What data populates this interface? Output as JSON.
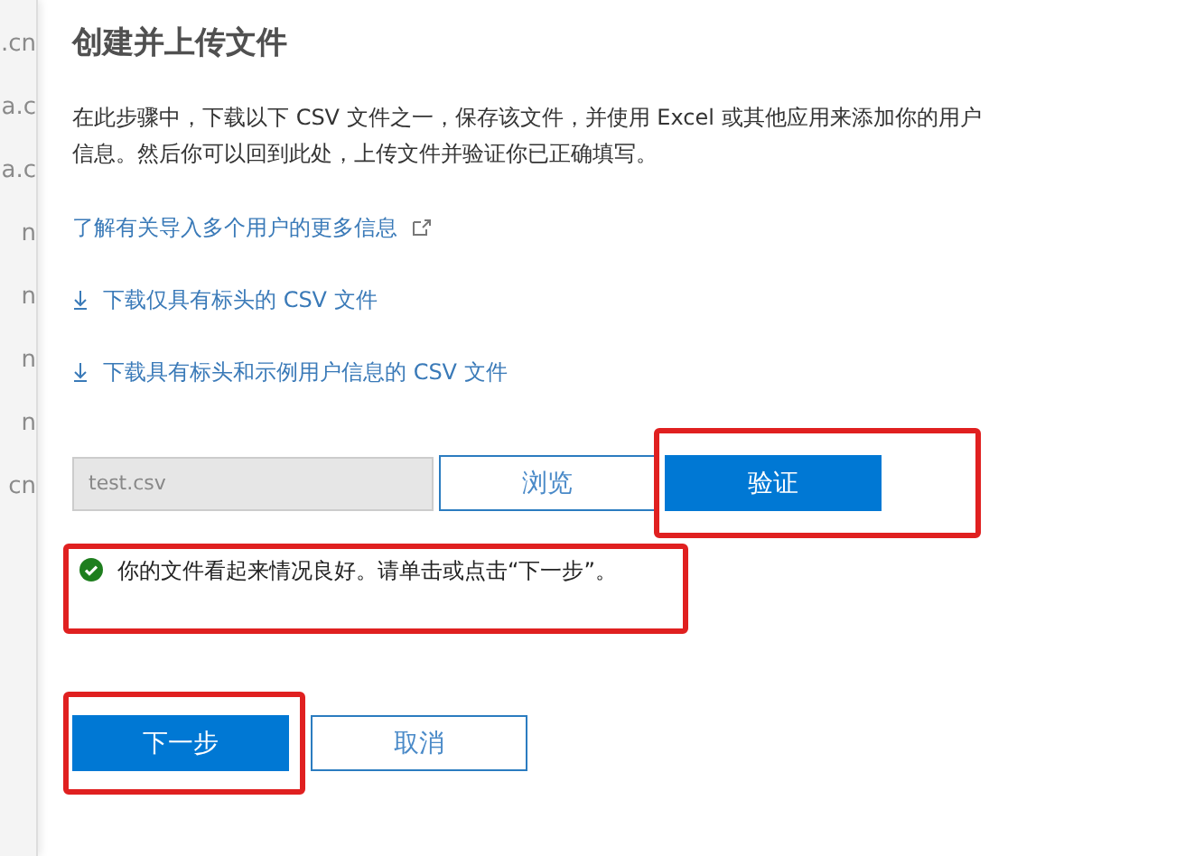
{
  "background_fragments": [
    ".cn",
    "a.c",
    "a.c",
    "n",
    "n",
    "n",
    "n",
    "cn"
  ],
  "panel": {
    "title": "创建并上传文件",
    "description": "在此步骤中，下载以下 CSV 文件之一，保存该文件，并使用 Excel 或其他应用来添加你的用户信息。然后你可以回到此处，上传文件并验证你已正确填写。",
    "links": [
      {
        "kind": "external",
        "label": "了解有关导入多个用户的更多信息"
      },
      {
        "kind": "download",
        "label": "下载仅具有标头的 CSV 文件"
      },
      {
        "kind": "download",
        "label": "下载具有标头和示例用户信息的 CSV 文件"
      }
    ],
    "file_field": {
      "value": "test.csv",
      "disabled": true
    },
    "browse_button": {
      "label": "浏览",
      "highlighted": false
    },
    "validate_button": {
      "label": "验证",
      "highlighted": true
    },
    "status": {
      "kind": "success",
      "message": "你的文件看起来情况良好。请单击或点击“下一步”。",
      "highlighted": true
    },
    "footer_buttons": [
      {
        "label": "下一步",
        "primary": true,
        "highlighted": true
      },
      {
        "label": "取消",
        "primary": false,
        "highlighted": false
      }
    ]
  }
}
